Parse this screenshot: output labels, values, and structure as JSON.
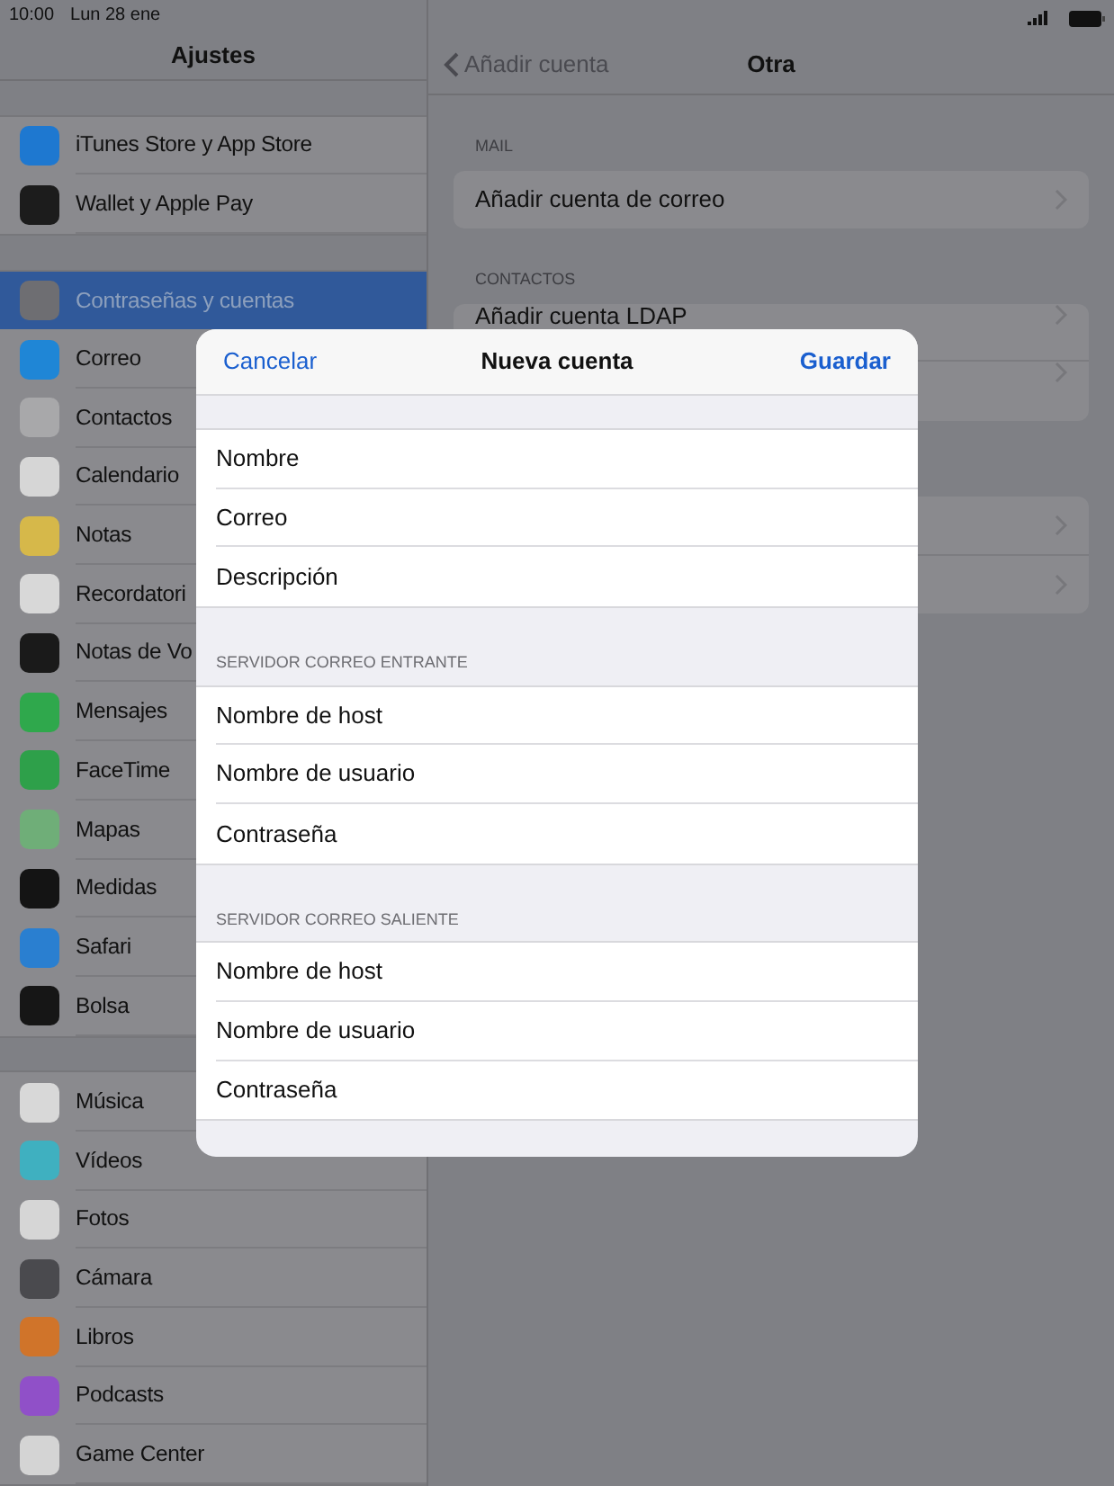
{
  "status_bar": {
    "time": "10:00",
    "date": "Lun 28 ene"
  },
  "sidebar": {
    "title": "Ajustes",
    "groups": [
      {
        "items": [
          {
            "label": "iTunes Store y App Store",
            "color": "#1e78d0",
            "selected": false
          },
          {
            "label": "Wallet y Apple Pay",
            "color": "#1c1c1c",
            "selected": false
          }
        ]
      },
      {
        "items": [
          {
            "label": "Contraseñas y cuentas",
            "color": "#6e6e72",
            "selected": true
          },
          {
            "label": "Correo",
            "color": "#1f86d6",
            "selected": false
          },
          {
            "label": "Contactos",
            "color": "#a8a8aa",
            "selected": false
          },
          {
            "label": "Calendario",
            "color": "#d6d6d6",
            "selected": false
          },
          {
            "label": "Notas",
            "color": "#d6b84a",
            "selected": false
          },
          {
            "label": "Recordatori",
            "color": "#d8d8d8",
            "selected": false
          },
          {
            "label": "Notas de Vo",
            "color": "#1a1a1a",
            "selected": false
          },
          {
            "label": "Mensajes",
            "color": "#2fa84c",
            "selected": false
          },
          {
            "label": "FaceTime",
            "color": "#2ea04a",
            "selected": false
          },
          {
            "label": "Mapas",
            "color": "#6fae78",
            "selected": false
          },
          {
            "label": "Medidas",
            "color": "#141414",
            "selected": false
          },
          {
            "label": "Safari",
            "color": "#2a7fd0",
            "selected": false
          },
          {
            "label": "Bolsa",
            "color": "#161616",
            "selected": false
          }
        ]
      },
      {
        "items": [
          {
            "label": "Música",
            "color": "#d8d8d8",
            "selected": false
          },
          {
            "label": "Vídeos",
            "color": "#3fb0c0",
            "selected": false
          },
          {
            "label": "Fotos",
            "color": "#d6d6d6",
            "selected": false
          },
          {
            "label": "Cámara",
            "color": "#4a4a4e",
            "selected": false
          },
          {
            "label": "Libros",
            "color": "#d0742a",
            "selected": false
          },
          {
            "label": "Podcasts",
            "color": "#9050c8",
            "selected": false
          },
          {
            "label": "Game Center",
            "color": "#d4d4d4",
            "selected": false
          }
        ]
      }
    ]
  },
  "detail": {
    "back": "Añadir cuenta",
    "title": "Otra",
    "sections": [
      {
        "header": "MAIL",
        "rows": [
          {
            "label": "Añadir cuenta de correo"
          }
        ]
      },
      {
        "header": "CONTACTOS",
        "rows": [
          {
            "label": "Añadir cuenta LDAP"
          },
          {}
        ]
      },
      {
        "rows": [
          {},
          {}
        ]
      }
    ]
  },
  "dialog": {
    "cancel": "Cancelar",
    "title": "Nueva cuenta",
    "save": "Guardar",
    "sections": [
      {
        "fields": [
          "Nombre",
          "Correo",
          "Descripción"
        ]
      },
      {
        "header": "SERVIDOR CORREO ENTRANTE",
        "fields": [
          "Nombre de host",
          "Nombre de usuario",
          "Contraseña"
        ]
      },
      {
        "header": "SERVIDOR CORREO SALIENTE",
        "fields": [
          "Nombre de host",
          "Nombre de usuario",
          "Contraseña"
        ]
      }
    ]
  }
}
